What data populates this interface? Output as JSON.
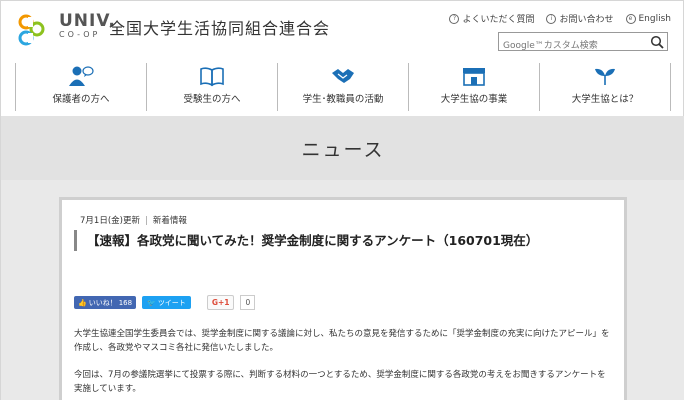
{
  "header": {
    "logo_univ": "UNIV.",
    "logo_coop": "CO-OP",
    "site_name": "全国大学生活協同組合連合会",
    "links": [
      {
        "label": "よくいただく質問",
        "icon": "question-icon"
      },
      {
        "label": "お問い合わせ",
        "icon": "info-icon"
      },
      {
        "label": "English",
        "icon": "globe-icon"
      }
    ],
    "search_placeholder": "Google™カスタム検索"
  },
  "nav": {
    "items": [
      {
        "label": "保護者の方へ",
        "icon": "parent-icon"
      },
      {
        "label": "受験生の方へ",
        "icon": "book-icon"
      },
      {
        "label": "学生･教職員の活動",
        "icon": "handshake-icon"
      },
      {
        "label": "大学生協の事業",
        "icon": "shop-icon"
      },
      {
        "label": "大学生協とは？",
        "icon": "sprout-icon"
      }
    ]
  },
  "banner": {
    "title": "ニュース"
  },
  "article": {
    "date": "7月1日(金)更新",
    "category": "新着情報",
    "title": "【速報】各政党に聞いてみた！奨学金制度に関するアンケート（160701現在）",
    "like_label": "いいね！",
    "like_count": "168",
    "tweet_label": "ツイート",
    "gplus_label": "G+1",
    "gplus_count": "0",
    "paragraphs": [
      "大学生協連全国学生委員会では、奨学金制度に関する議論に対し、私たちの意見を発信するために「奨学金制度の充実に向けたアピール」を作成し、各政党やマスコミ各社に発信いたしました。",
      "今回は、7月の参議院選挙にて投票する際に、判断する材料の一つとするため、奨学金制度に関する各政党の考えをお聞きするアンケートを実施しています。"
    ]
  },
  "colors": {
    "logo_orange": "#f39800",
    "logo_green": "#8dc21f",
    "logo_blue": "#2ca6e0",
    "nav_icon": "#1b6fb6",
    "facebook": "#4267b2",
    "twitter": "#1da1f2",
    "gplus": "#dd4b39"
  }
}
